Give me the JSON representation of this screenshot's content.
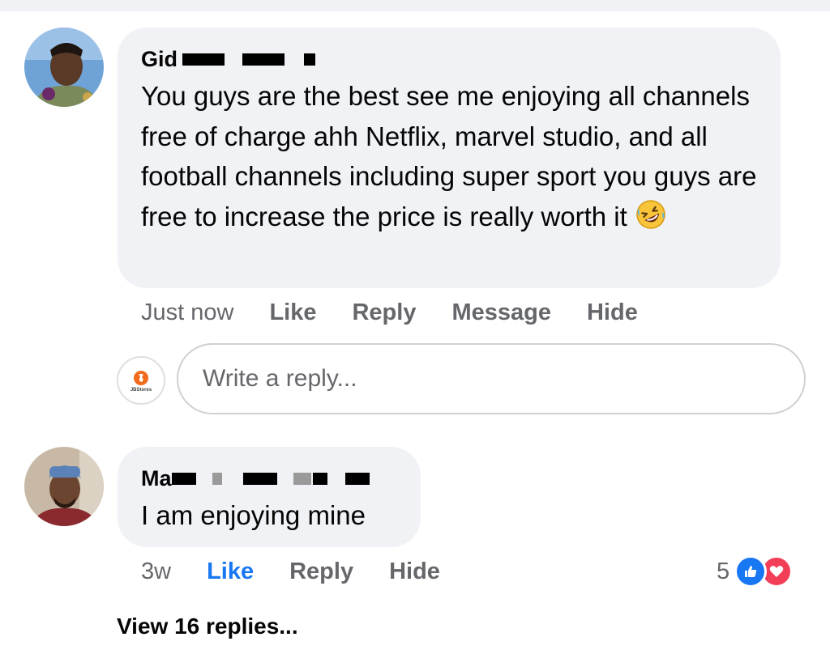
{
  "comment1": {
    "author_visible": "Gid",
    "text": "You guys are the best see me enjoying all channels free of charge ahh Netflix, marvel studio, and all football channels including super sport you guys are free to increase the price is really worth it",
    "emoji_icon": "rolling-on-floor-laughing-emoji",
    "time": "Just now",
    "actions": {
      "like": "Like",
      "reply": "Reply",
      "message": "Message",
      "hide": "Hide"
    }
  },
  "reply_composer": {
    "placeholder": "Write a reply...",
    "page_logo_text": "JBStores",
    "page_logo_color": "#f26b1d"
  },
  "comment2": {
    "author_visible": "Ma",
    "text": "I am enjoying mine",
    "time": "3w",
    "actions": {
      "like": "Like",
      "reply": "Reply",
      "hide": "Hide"
    },
    "reaction_count": "5",
    "reaction_icons": [
      "like-icon",
      "love-icon"
    ]
  },
  "view_replies": "View 16 replies...",
  "colors": {
    "bubble": "#f0f2f5",
    "secondary_text": "#65676b",
    "like_blue": "#1877f2",
    "love_red": "#f33e58"
  }
}
